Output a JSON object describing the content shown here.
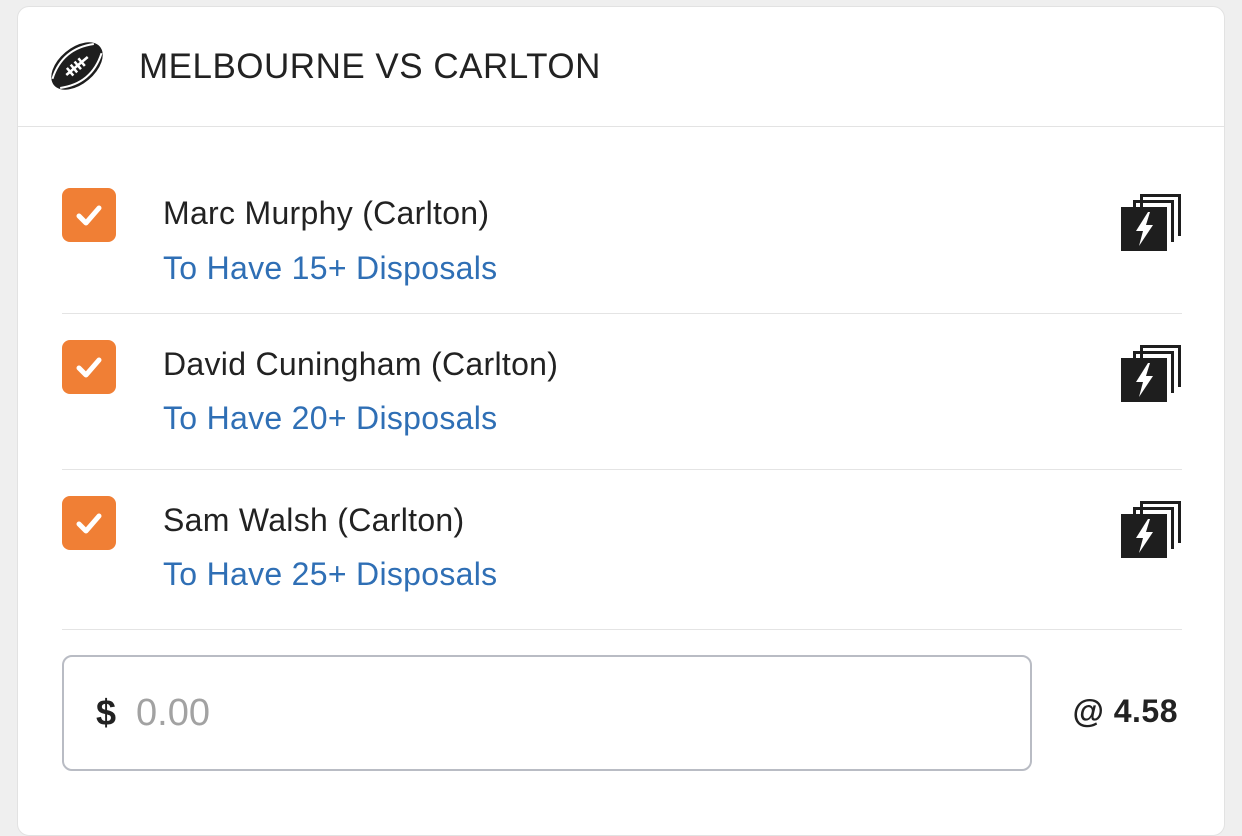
{
  "header": {
    "sport_icon": "australian-football-icon",
    "title": "MELBOURNE VS CARLTON"
  },
  "legs": [
    {
      "selected": true,
      "name": "Marc Murphy (Carlton)",
      "market": "To Have 15+ Disposals",
      "icon": "same-game-multi-icon"
    },
    {
      "selected": true,
      "name": "David Cuningham (Carlton)",
      "market": "To Have 20+ Disposals",
      "icon": "same-game-multi-icon"
    },
    {
      "selected": true,
      "name": "Sam Walsh (Carlton)",
      "market": "To Have 25+ Disposals",
      "icon": "same-game-multi-icon"
    }
  ],
  "stake": {
    "currency": "$",
    "placeholder": "0.00",
    "odds": "@ 4.58"
  },
  "colors": {
    "checkbox": "#f07f35",
    "market_link": "#2f6fb5",
    "text": "#222222"
  }
}
